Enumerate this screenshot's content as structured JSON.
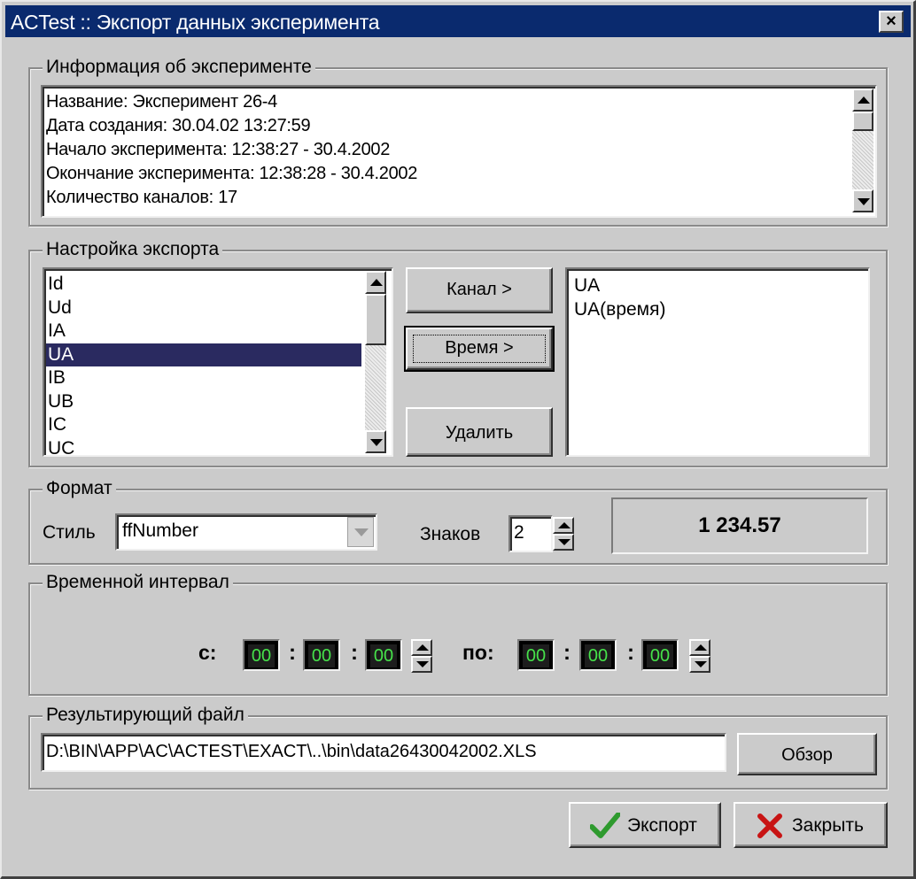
{
  "window": {
    "title": "ACTest :: Экспорт данных эксперимента",
    "close_symbol": "×"
  },
  "info": {
    "legend": "Информация об эксперименте",
    "lines": [
      "Название: Эксперимент 26-4",
      "Дата создания: 30.04.02 13:27:59",
      "Начало эксперимента: 12:38:27 - 30.4.2002",
      "Окончание эксперимента: 12:38:28 - 30.4.2002",
      "Количество каналов: 17"
    ]
  },
  "export_settings": {
    "legend": "Настройка экспорта",
    "channels": [
      "Id",
      "Ud",
      "IA",
      "UA",
      "IB",
      "UB",
      "IC",
      "UC"
    ],
    "selected_channel": "UA",
    "channel_button": "Канал >",
    "time_button": "Время >",
    "delete_button": "Удалить",
    "export_list": [
      "UA",
      "UA(время)"
    ]
  },
  "format": {
    "legend": "Формат",
    "style_label": "Стиль",
    "style_value": "ffNumber",
    "digits_label": "Знаков",
    "digits_value": "2",
    "preview": "1 234.57"
  },
  "interval": {
    "legend": "Временной интервал",
    "from_label": "с:",
    "to_label": "по:",
    "from": [
      "00",
      "00",
      "00"
    ],
    "to": [
      "00",
      "00",
      "00"
    ]
  },
  "result_file": {
    "legend": "Результирующий файл",
    "path": "D:\\BIN\\APP\\AC\\ACTEST\\EXACT\\..\\bin\\data26430042002.XLS",
    "browse_button": "Обзор"
  },
  "footer": {
    "export_button": "Экспорт",
    "close_button": "Закрыть"
  },
  "colors": {
    "titlebar": "#0a2a6e",
    "face": "#cbcbcb",
    "selection": "#2a2a60",
    "time_digits": "#46e24a",
    "check_icon": "#2e9a2e",
    "close_icon": "#c81414"
  }
}
